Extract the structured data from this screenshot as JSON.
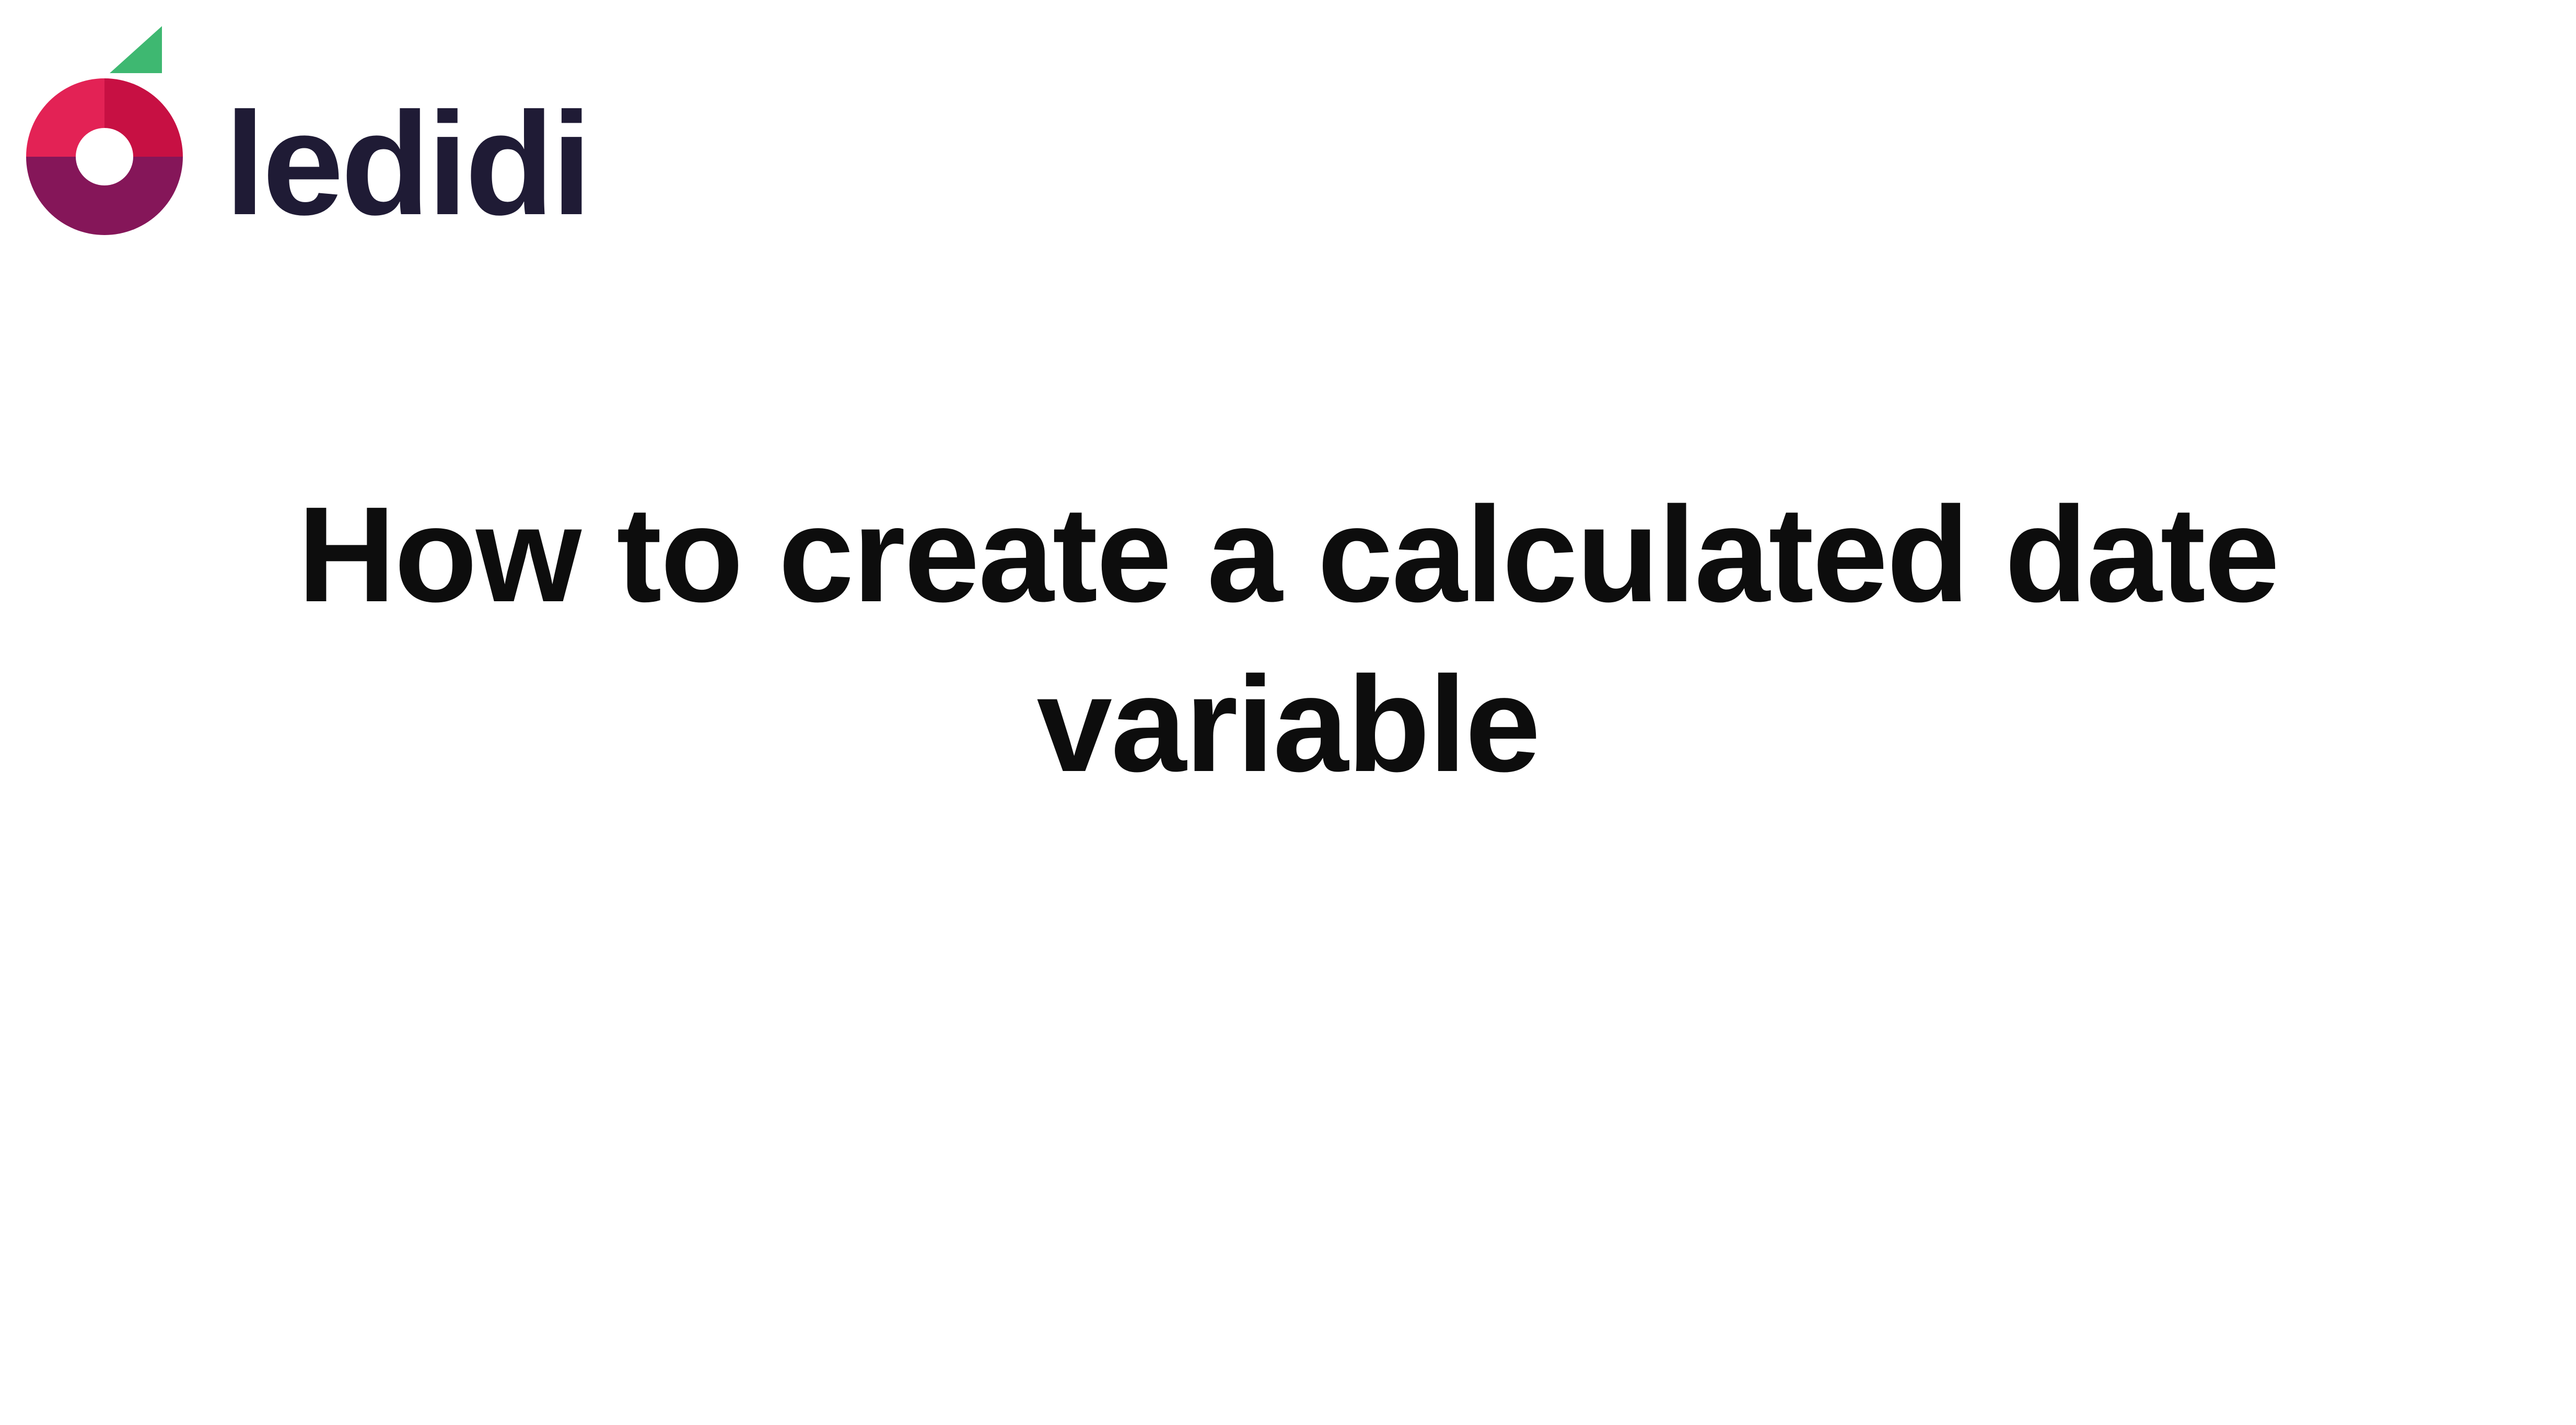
{
  "brand": {
    "name": "ledidi",
    "colors": {
      "leaf": "#3eb871",
      "circle_top_left": "#e32255",
      "circle_top_right": "#c71043",
      "circle_bottom": "#851659",
      "text": "#1f1b35"
    }
  },
  "title": "How to create a calculated date variable"
}
